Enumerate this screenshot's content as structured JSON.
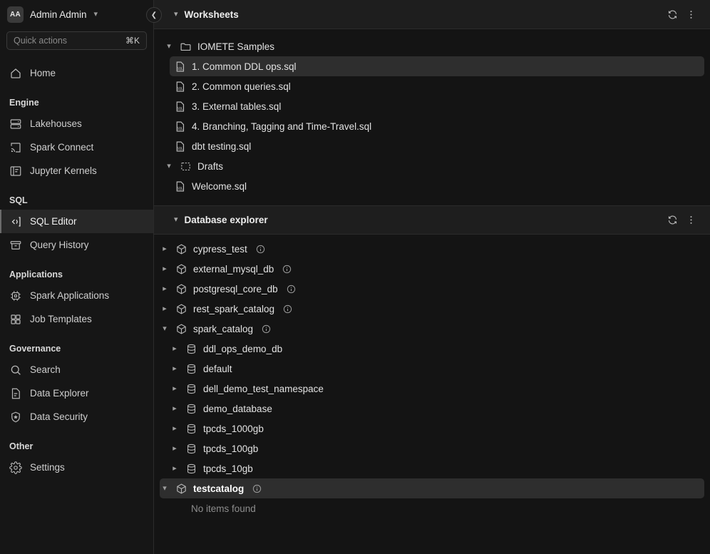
{
  "sidebar": {
    "user": {
      "initials": "AA",
      "name": "Admin Admin",
      "chevron": "chevron-down-icon"
    },
    "quick_actions": {
      "placeholder": "Quick actions",
      "shortcut": "⌘K"
    },
    "home": {
      "label": "Home",
      "icon": "home-icon"
    },
    "sections": [
      {
        "label": "Engine",
        "items": [
          {
            "label": "Lakehouses",
            "icon": "server-icon",
            "active": false
          },
          {
            "label": "Spark Connect",
            "icon": "cast-icon",
            "active": false
          },
          {
            "label": "Jupyter Kernels",
            "icon": "notebook-icon",
            "active": false
          }
        ]
      },
      {
        "label": "SQL",
        "items": [
          {
            "label": "SQL Editor",
            "icon": "code-icon",
            "active": true
          },
          {
            "label": "Query History",
            "icon": "archive-icon",
            "active": false
          }
        ]
      },
      {
        "label": "Applications",
        "items": [
          {
            "label": "Spark Applications",
            "icon": "cpu-icon",
            "active": false
          },
          {
            "label": "Job Templates",
            "icon": "grid-icon",
            "active": false
          }
        ]
      },
      {
        "label": "Governance",
        "items": [
          {
            "label": "Search",
            "icon": "search-icon",
            "active": false
          },
          {
            "label": "Data Explorer",
            "icon": "document-icon",
            "active": false
          },
          {
            "label": "Data Security",
            "icon": "shield-icon",
            "active": false
          }
        ]
      },
      {
        "label": "Other",
        "items": [
          {
            "label": "Settings",
            "icon": "gear-icon",
            "active": false
          }
        ]
      }
    ]
  },
  "collapse_button": {
    "icon": "chevron-left-icon"
  },
  "worksheets": {
    "title": "Worksheets",
    "twisty": "chevron-down-icon",
    "refresh_icon": "refresh-icon",
    "menu_icon": "more-vertical-icon",
    "tree": [
      {
        "label": "IOMETE Samples",
        "icon": "folder-icon",
        "arrow": "chevron-down-icon",
        "level": 0,
        "selected": false
      },
      {
        "label": "1. Common DDL ops.sql",
        "icon": "sql-file-icon",
        "arrow": "",
        "level": 1,
        "selected": true
      },
      {
        "label": "2. Common queries.sql",
        "icon": "sql-file-icon",
        "arrow": "",
        "level": 1,
        "selected": false
      },
      {
        "label": "3. External tables.sql",
        "icon": "sql-file-icon",
        "arrow": "",
        "level": 1,
        "selected": false
      },
      {
        "label": "4. Branching, Tagging and Time-Travel.sql",
        "icon": "sql-file-icon",
        "arrow": "",
        "level": 1,
        "selected": false
      },
      {
        "label": "dbt testing.sql",
        "icon": "sql-file-icon",
        "arrow": "",
        "level": 1,
        "selected": false
      },
      {
        "label": "Drafts",
        "icon": "drafts-icon",
        "arrow": "chevron-down-icon",
        "level": 0,
        "selected": false
      },
      {
        "label": "Welcome.sql",
        "icon": "sql-file-icon",
        "arrow": "",
        "level": 1,
        "selected": false
      }
    ]
  },
  "database_explorer": {
    "title": "Database explorer",
    "twisty": "chevron-down-icon",
    "refresh_icon": "refresh-icon",
    "menu_icon": "more-vertical-icon",
    "empty_message": "No items found",
    "tree": [
      {
        "label": "cypress_test",
        "icon": "catalog-icon",
        "arrow": "chevron-right-icon",
        "level": 0,
        "info": true,
        "selected": false,
        "bold": false
      },
      {
        "label": "external_mysql_db",
        "icon": "catalog-icon",
        "arrow": "chevron-right-icon",
        "level": 0,
        "info": true,
        "selected": false,
        "bold": false
      },
      {
        "label": "postgresql_core_db",
        "icon": "catalog-icon",
        "arrow": "chevron-right-icon",
        "level": 0,
        "info": true,
        "selected": false,
        "bold": false
      },
      {
        "label": "rest_spark_catalog",
        "icon": "catalog-icon",
        "arrow": "chevron-right-icon",
        "level": 0,
        "info": true,
        "selected": false,
        "bold": false
      },
      {
        "label": "spark_catalog",
        "icon": "catalog-icon",
        "arrow": "chevron-down-icon",
        "level": 0,
        "info": true,
        "selected": false,
        "bold": false
      },
      {
        "label": "ddl_ops_demo_db",
        "icon": "database-icon",
        "arrow": "chevron-right-icon",
        "level": 1,
        "info": false,
        "selected": false,
        "bold": false
      },
      {
        "label": "default",
        "icon": "database-icon",
        "arrow": "chevron-right-icon",
        "level": 1,
        "info": false,
        "selected": false,
        "bold": false
      },
      {
        "label": "dell_demo_test_namespace",
        "icon": "database-icon",
        "arrow": "chevron-right-icon",
        "level": 1,
        "info": false,
        "selected": false,
        "bold": false
      },
      {
        "label": "demo_database",
        "icon": "database-icon",
        "arrow": "chevron-right-icon",
        "level": 1,
        "info": false,
        "selected": false,
        "bold": false
      },
      {
        "label": "tpcds_1000gb",
        "icon": "database-icon",
        "arrow": "chevron-right-icon",
        "level": 1,
        "info": false,
        "selected": false,
        "bold": false
      },
      {
        "label": "tpcds_100gb",
        "icon": "database-icon",
        "arrow": "chevron-right-icon",
        "level": 1,
        "info": false,
        "selected": false,
        "bold": false
      },
      {
        "label": "tpcds_10gb",
        "icon": "database-icon",
        "arrow": "chevron-right-icon",
        "level": 1,
        "info": false,
        "selected": false,
        "bold": false
      },
      {
        "label": "testcatalog",
        "icon": "catalog-icon",
        "arrow": "chevron-down-icon",
        "level": 0,
        "info": true,
        "selected": true,
        "bold": true
      }
    ]
  },
  "colors": {
    "background": "#141414",
    "sidebar": "#161616",
    "header": "#1e1e1e",
    "selection": "#2e2e2e",
    "sql_file_accent": "#4a9be8",
    "text_primary": "#e9e9e9",
    "text_muted": "#8d8d8d"
  }
}
